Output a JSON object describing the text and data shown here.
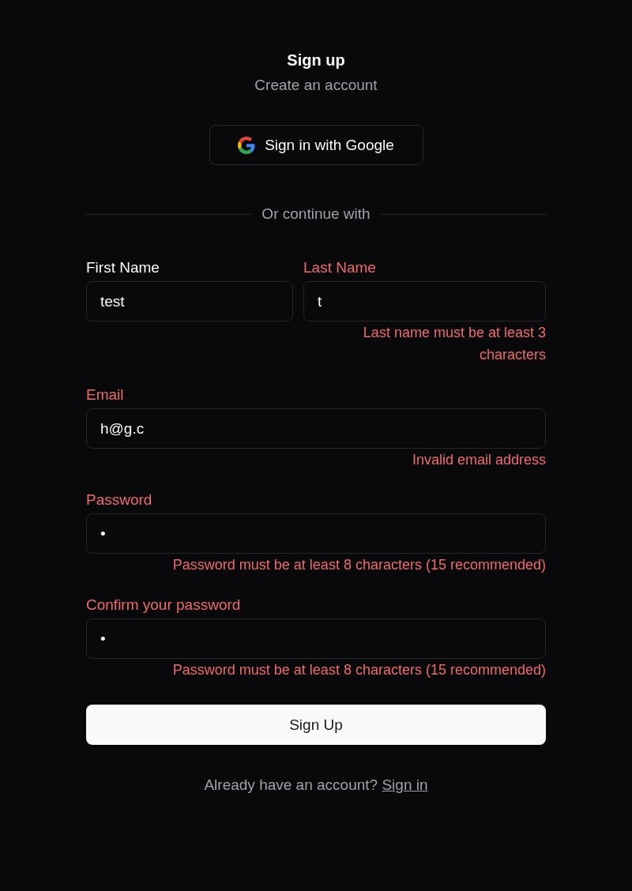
{
  "header": {
    "title": "Sign up",
    "subtitle": "Create an account"
  },
  "google_button": {
    "label": "Sign in with Google"
  },
  "divider": {
    "label": "Or continue with"
  },
  "name_row": [
    {
      "label": "First Name",
      "value": "test",
      "invalid": false
    },
    {
      "label": "Last Name",
      "value": "t",
      "invalid": true,
      "error": "Last name must be at least 3 characters"
    }
  ],
  "fields": [
    {
      "label": "Email",
      "value": "h@g.c",
      "invalid": true,
      "error": "Invalid email address"
    },
    {
      "label": "Password",
      "value": "•",
      "invalid": true,
      "error": "Password must be at least 8 characters (15 recommended)"
    },
    {
      "label": "Confirm your password",
      "value": "•",
      "invalid": true,
      "error": "Password must be at least 8 characters (15 recommended)"
    }
  ],
  "submit_button": {
    "label": "Sign Up"
  },
  "footer": {
    "text": "Already have an account?",
    "link": "Sign in"
  }
}
